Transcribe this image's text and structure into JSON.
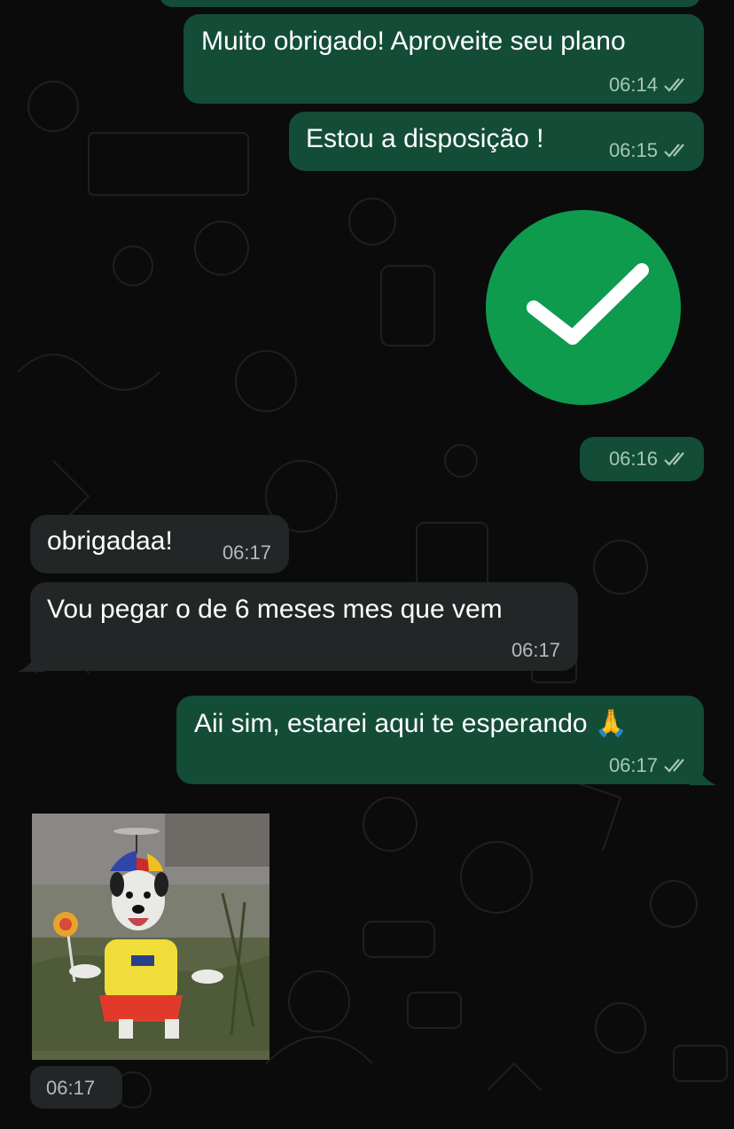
{
  "messages": [
    {
      "id": "m1",
      "direction": "outgoing",
      "text": "Muito obrigado! Aproveite seu plano",
      "time": "06:14",
      "status": "read"
    },
    {
      "id": "m2",
      "direction": "outgoing",
      "text": "Estou a disposição !",
      "time": "06:15",
      "status": "read"
    },
    {
      "id": "m3",
      "direction": "outgoing",
      "type": "sticker",
      "sticker": "green-checkmark",
      "time": "06:16",
      "status": "read"
    },
    {
      "id": "m4",
      "direction": "incoming",
      "text": "obrigadaa!",
      "time": "06:17"
    },
    {
      "id": "m5",
      "direction": "incoming",
      "text": "Vou pegar o de 6 meses mes que vem",
      "time": "06:17"
    },
    {
      "id": "m6",
      "direction": "outgoing",
      "text": "Aii sim, estarei aqui te esperando 🙏",
      "time": "06:17",
      "status": "read"
    },
    {
      "id": "m7",
      "direction": "incoming",
      "type": "sticker",
      "sticker": "dog-with-propeller-hat",
      "time": "06:17"
    }
  ],
  "colors": {
    "outgoing_bubble": "#144d37",
    "incoming_bubble": "#232626",
    "background": "#0b0b0b",
    "check_sticker": "#0e9b4e"
  },
  "icons": {
    "read_receipt": "double-check-icon"
  }
}
